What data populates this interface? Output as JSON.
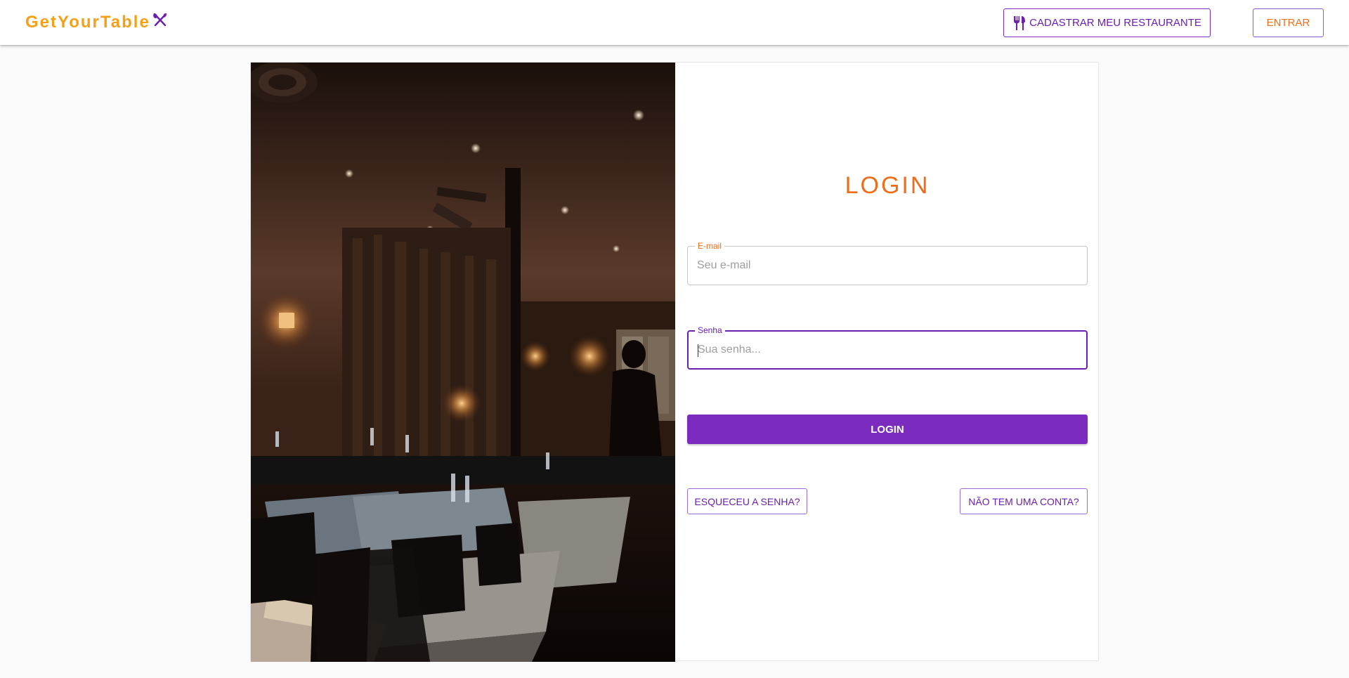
{
  "header": {
    "brand": "GetYourTable",
    "register_button": "CADASTRAR MEU RESTAURANTE",
    "enter_button": "ENTRAR"
  },
  "login": {
    "title": "LOGIN",
    "email_label": "E-mail",
    "email_placeholder": "Seu e-mail",
    "email_value": "",
    "password_label": "Senha",
    "password_placeholder": "Sua senha...",
    "password_value": "",
    "submit_button": "LOGIN",
    "forgot_button": "ESQUECEU A SENHA?",
    "no_account_button": "NÃO TEM UMA CONTA?"
  },
  "icons": {
    "brand": "utensils-crossed-icon",
    "register": "fork-knife-icon"
  },
  "colors": {
    "brand": "#f5a019",
    "accent_orange": "#ef6c1a",
    "accent_purple": "#7b2cbf"
  }
}
